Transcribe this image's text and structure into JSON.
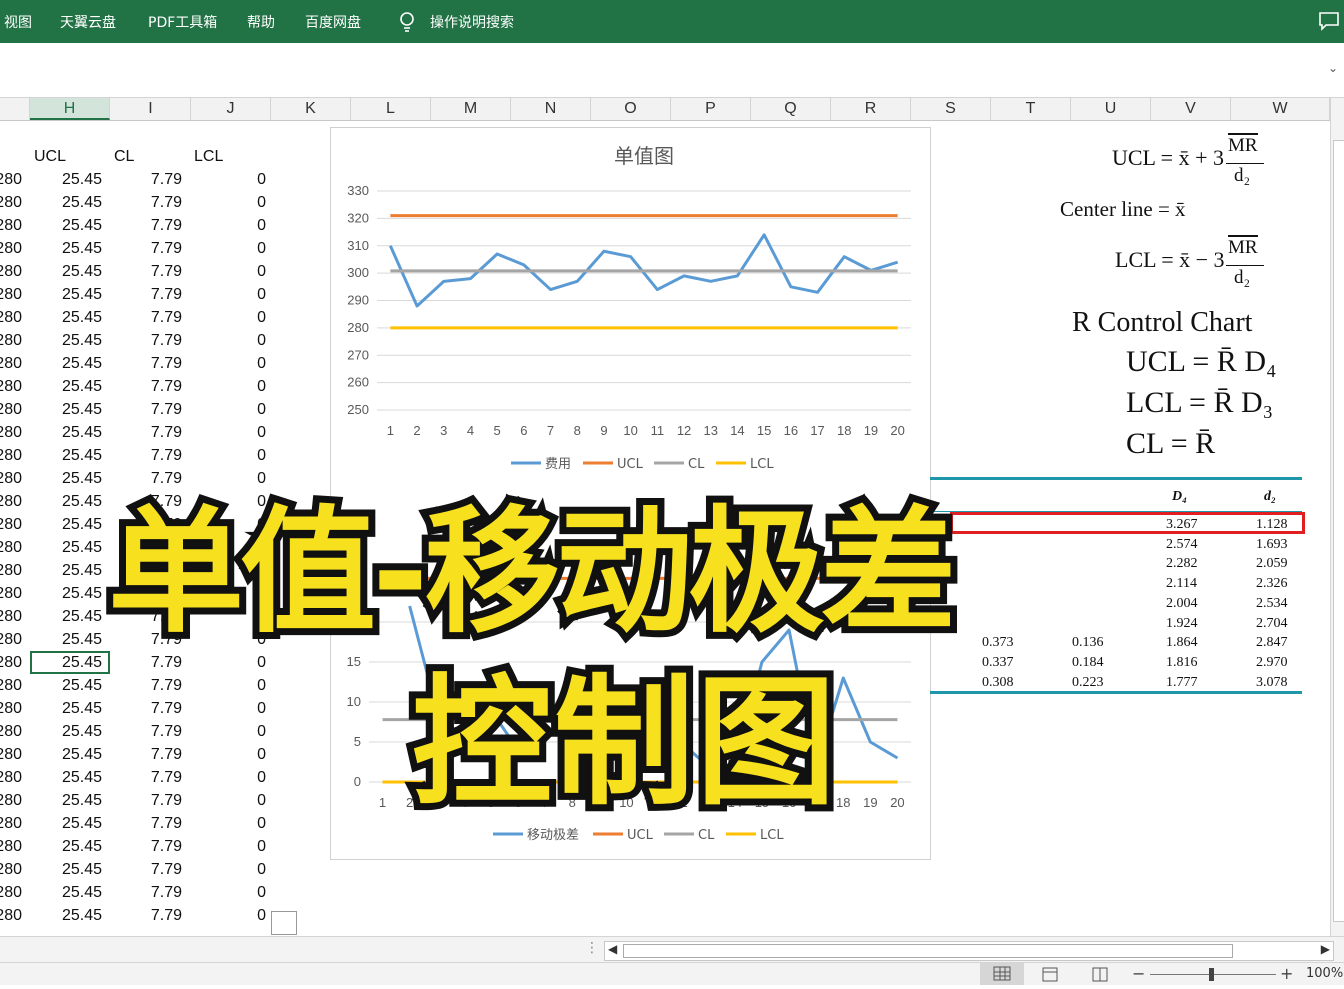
{
  "menu": [
    "视图",
    "天翼云盘",
    "PDF工具箱",
    "帮助",
    "百度网盘"
  ],
  "search_label": "操作说明搜索",
  "columns": [
    "H",
    "I",
    "J",
    "K",
    "L",
    "M",
    "N",
    "O",
    "P",
    "Q",
    "R",
    "S",
    "T",
    "U",
    "V",
    "W"
  ],
  "selected_column": "H",
  "headers": {
    "ucl": "UCL",
    "cl": "CL",
    "lcl": "LCL"
  },
  "row_values": {
    "g": "280",
    "ucl": "25.45",
    "cl": "7.79",
    "lcl": "0"
  },
  "row_count": 33,
  "selected_row_index": 21,
  "chart_data": [
    {
      "type": "line",
      "title": "单值图",
      "x": [
        1,
        2,
        3,
        4,
        5,
        6,
        7,
        8,
        9,
        10,
        11,
        12,
        13,
        14,
        15,
        16,
        17,
        18,
        19,
        20
      ],
      "ylim": [
        250,
        330
      ],
      "yticks": [
        250,
        260,
        270,
        280,
        290,
        300,
        310,
        320,
        330
      ],
      "series": [
        {
          "name": "费用",
          "color": "#5b9bd5",
          "values": [
            310,
            288,
            297,
            298,
            307,
            303,
            294,
            297,
            308,
            306,
            294,
            299,
            297,
            299,
            314,
            295,
            293,
            306,
            301,
            304
          ]
        },
        {
          "name": "UCL",
          "color": "#ed7d31",
          "values": [
            321,
            321,
            321,
            321,
            321,
            321,
            321,
            321,
            321,
            321,
            321,
            321,
            321,
            321,
            321,
            321,
            321,
            321,
            321,
            321
          ]
        },
        {
          "name": "CL",
          "color": "#a5a5a5",
          "values": [
            300.8,
            300.8,
            300.8,
            300.8,
            300.8,
            300.8,
            300.8,
            300.8,
            300.8,
            300.8,
            300.8,
            300.8,
            300.8,
            300.8,
            300.8,
            300.8,
            300.8,
            300.8,
            300.8,
            300.8
          ]
        },
        {
          "name": "LCL",
          "color": "#ffc000",
          "values": [
            280,
            280,
            280,
            280,
            280,
            280,
            280,
            280,
            280,
            280,
            280,
            280,
            280,
            280,
            280,
            280,
            280,
            280,
            280,
            280
          ]
        }
      ],
      "grid": true,
      "legend": "bottom"
    },
    {
      "type": "line",
      "title": "",
      "x": [
        1,
        2,
        3,
        4,
        5,
        6,
        7,
        8,
        9,
        10,
        11,
        12,
        13,
        14,
        15,
        16,
        17,
        18,
        19,
        20
      ],
      "ylim": [
        0,
        30
      ],
      "yticks": [
        0,
        5,
        10,
        15,
        20
      ],
      "series": [
        {
          "name": "移动极差",
          "color": "#5b9bd5",
          "values": [
            null,
            22,
            9,
            4,
            9,
            4,
            9,
            3,
            11,
            2,
            12,
            5,
            2,
            2,
            15,
            19,
            2,
            13,
            5,
            3
          ]
        },
        {
          "name": "UCL",
          "color": "#ed7d31",
          "values": [
            25.45,
            25.45,
            25.45,
            25.45,
            25.45,
            25.45,
            25.45,
            25.45,
            25.45,
            25.45,
            25.45,
            25.45,
            25.45,
            25.45,
            25.45,
            25.45,
            25.45,
            25.45,
            25.45,
            25.45
          ]
        },
        {
          "name": "CL",
          "color": "#a5a5a5",
          "values": [
            7.79,
            7.79,
            7.79,
            7.79,
            7.79,
            7.79,
            7.79,
            7.79,
            7.79,
            7.79,
            7.79,
            7.79,
            7.79,
            7.79,
            7.79,
            7.79,
            7.79,
            7.79,
            7.79,
            7.79
          ]
        },
        {
          "name": "LCL",
          "color": "#ffc000",
          "values": [
            0,
            0,
            0,
            0,
            0,
            0,
            0,
            0,
            0,
            0,
            0,
            0,
            0,
            0,
            0,
            0,
            0,
            0,
            0,
            0
          ]
        }
      ],
      "grid": true,
      "legend": "bottom"
    }
  ],
  "formulas": {
    "ucl_x": "UCL = x̄ + 3",
    "mr": "MR",
    "d2": "d₂",
    "center": "Center line = x̄",
    "lcl_x": "LCL = x̄ − 3",
    "r_title": "R Control Chart",
    "ucl_r": "UCL = R̄ D₄",
    "lcl_r": "LCL = R̄ D₃",
    "cl_r": "CL = R̄"
  },
  "table": {
    "headers": {
      "d4": "D₄",
      "d2": "d₂"
    },
    "rows": [
      [
        "",
        "",
        "3.267",
        "1.128"
      ],
      [
        "",
        "",
        "2.574",
        "1.693"
      ],
      [
        "",
        "",
        "2.282",
        "2.059"
      ],
      [
        "",
        "",
        "2.114",
        "2.326"
      ],
      [
        "",
        "",
        "2.004",
        "2.534"
      ],
      [
        "",
        "",
        "1.924",
        "2.704"
      ],
      [
        "0.373",
        "0.136",
        "1.864",
        "2.847"
      ],
      [
        "0.337",
        "0.184",
        "1.816",
        "2.970"
      ],
      [
        "0.308",
        "0.223",
        "1.777",
        "3.078"
      ]
    ]
  },
  "overlay": {
    "line1": "单值-移动极差",
    "line2": "控制图"
  },
  "zoom": "100%",
  "colors": {
    "ribbon": "#217346",
    "highlight": "#e02020",
    "table_rule": "#1f97a8",
    "title_fill": "#f7e11f"
  }
}
